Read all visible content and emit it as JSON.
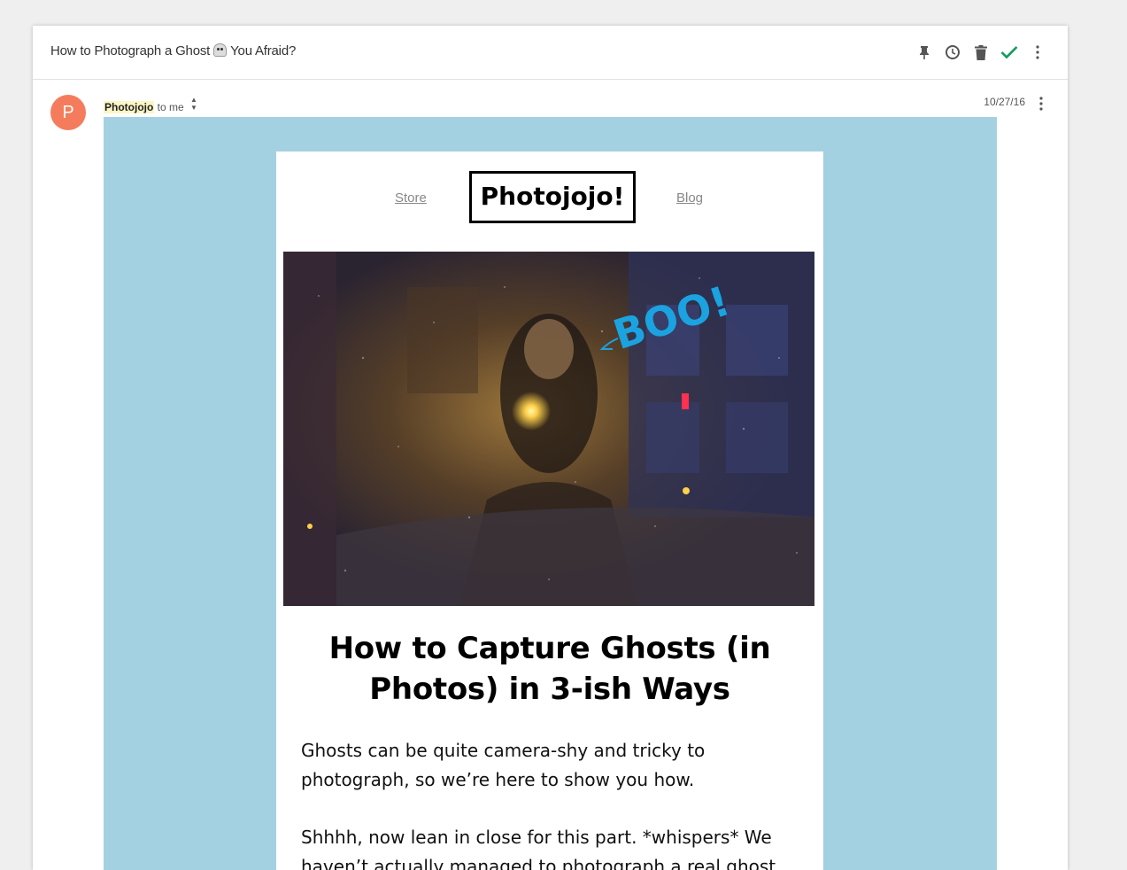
{
  "subject_bar": {
    "subject_before": "How to Photograph a Ghost",
    "subject_after": "You Afraid?",
    "actions": [
      {
        "name": "pin-icon"
      },
      {
        "name": "snooze-icon"
      },
      {
        "name": "trash-icon"
      },
      {
        "name": "done-check-icon",
        "color": "#0f9d58"
      },
      {
        "name": "more-vert-icon"
      }
    ]
  },
  "message": {
    "avatar_letter": "P",
    "avatar_color": "#f47c5c",
    "sender": "Photojojo",
    "recipient": "to me",
    "date": "10/27/16"
  },
  "email": {
    "background_color": "#a4d1e1",
    "nav_left": "Store",
    "logo": "Photojojo!",
    "nav_right": "Blog",
    "hero_overlay": "BOO!",
    "headline": "How to Capture Ghosts (in Photos) in 3-ish Ways",
    "paragraphs": [
      "Ghosts can be quite camera-shy and tricky to photograph, so we’re here to show you how.",
      "Shhhh, now lean in close for this part. *whispers* We haven’t actually managed to photograph a real ghost"
    ]
  }
}
